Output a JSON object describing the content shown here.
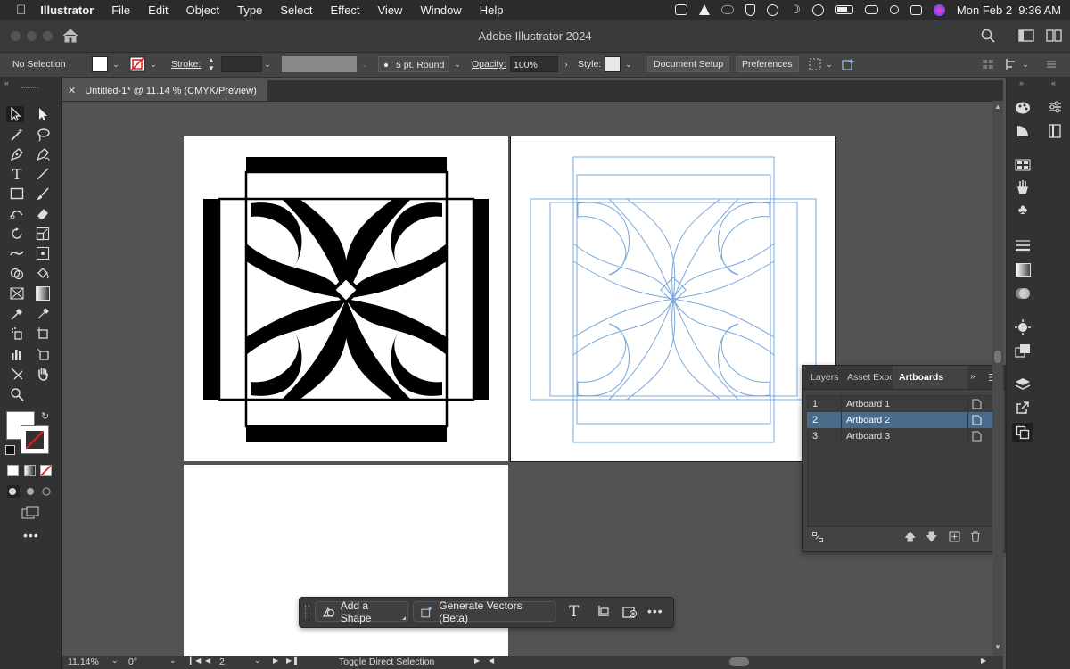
{
  "menubar": {
    "app_name": "Illustrator",
    "items": [
      "File",
      "Edit",
      "Object",
      "Type",
      "Select",
      "Effect",
      "View",
      "Window",
      "Help"
    ],
    "clock": "Mon Feb 2  9:36 AM"
  },
  "window": {
    "title": "Adobe Illustrator 2024"
  },
  "controlbar": {
    "selection_status": "No Selection",
    "stroke_label": "Stroke:",
    "brush_label": "5 pt. Round",
    "opacity_label": "Opacity:",
    "opacity_value": "100%",
    "style_label": "Style:",
    "document_setup_label": "Document Setup",
    "preferences_label": "Preferences"
  },
  "document": {
    "tab_title": "Untitled-1* @ 11.14 % (CMYK/Preview)"
  },
  "artboards_panel": {
    "tabs": [
      "Layers",
      "Asset Expo",
      "Artboards"
    ],
    "active_tab": "Artboards",
    "rows": [
      {
        "num": "1",
        "name": "Artboard 1"
      },
      {
        "num": "2",
        "name": "Artboard 2"
      },
      {
        "num": "3",
        "name": "Artboard 3"
      }
    ],
    "selected_index": 1
  },
  "context_bar": {
    "add_shape_label": "Add a Shape",
    "generate_vectors_label": "Generate Vectors (Beta)"
  },
  "statusbar": {
    "zoom": "11.14%",
    "rotation": "0°",
    "artboard_number": "2",
    "status_text": "Toggle Direct Selection"
  },
  "colors": {
    "ui_background": "#535353",
    "panel_dark": "#323232",
    "selection_row": "#4a6a8a",
    "outline_blue": "#7aa8dd"
  }
}
